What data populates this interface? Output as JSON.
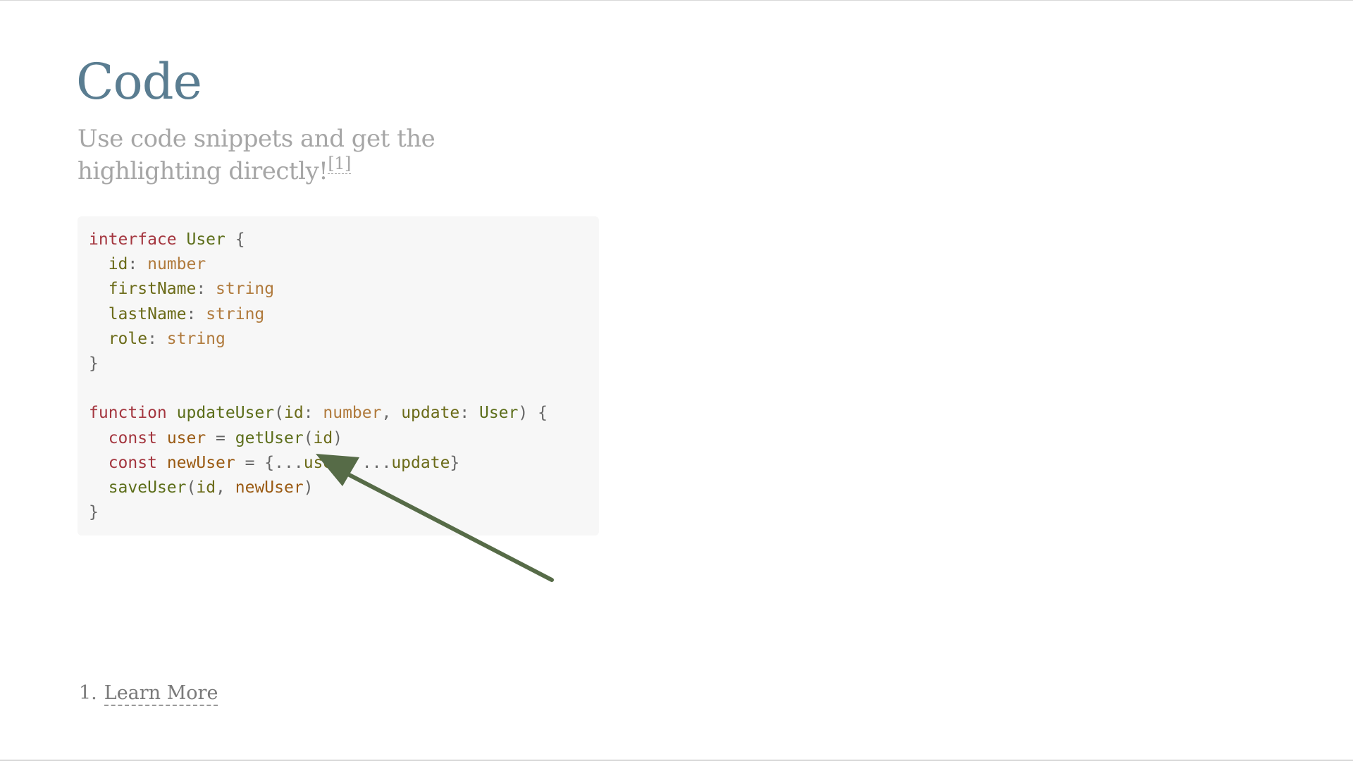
{
  "slide": {
    "title": "Code",
    "subtitle": "Use code snippets and get the highlighting directly!",
    "footnote_ref": "[1]"
  },
  "code": {
    "lines": [
      [
        {
          "t": "interface",
          "c": "kw"
        },
        {
          "t": " "
        },
        {
          "t": "User",
          "c": "ty"
        },
        {
          "t": " {",
          "c": "pn"
        }
      ],
      [
        {
          "t": "  "
        },
        {
          "t": "id",
          "c": "prop"
        },
        {
          "t": ": ",
          "c": "pn"
        },
        {
          "t": "number",
          "c": "bt"
        }
      ],
      [
        {
          "t": "  "
        },
        {
          "t": "firstName",
          "c": "prop"
        },
        {
          "t": ": ",
          "c": "pn"
        },
        {
          "t": "string",
          "c": "bt"
        }
      ],
      [
        {
          "t": "  "
        },
        {
          "t": "lastName",
          "c": "prop"
        },
        {
          "t": ": ",
          "c": "pn"
        },
        {
          "t": "string",
          "c": "bt"
        }
      ],
      [
        {
          "t": "  "
        },
        {
          "t": "role",
          "c": "prop"
        },
        {
          "t": ": ",
          "c": "pn"
        },
        {
          "t": "string",
          "c": "bt"
        }
      ],
      [
        {
          "t": "}",
          "c": "pn"
        }
      ],
      [],
      [
        {
          "t": "function",
          "c": "kw"
        },
        {
          "t": " "
        },
        {
          "t": "updateUser",
          "c": "fn"
        },
        {
          "t": "(",
          "c": "pn"
        },
        {
          "t": "id",
          "c": "prop"
        },
        {
          "t": ": ",
          "c": "pn"
        },
        {
          "t": "number",
          "c": "bt"
        },
        {
          "t": ", ",
          "c": "pn"
        },
        {
          "t": "update",
          "c": "prop"
        },
        {
          "t": ": ",
          "c": "pn"
        },
        {
          "t": "User",
          "c": "ty"
        },
        {
          "t": ") {",
          "c": "pn"
        }
      ],
      [
        {
          "t": "  "
        },
        {
          "t": "const",
          "c": "kw"
        },
        {
          "t": " "
        },
        {
          "t": "user",
          "c": "var"
        },
        {
          "t": " = ",
          "c": "op"
        },
        {
          "t": "getUser",
          "c": "fn"
        },
        {
          "t": "(",
          "c": "pn"
        },
        {
          "t": "id",
          "c": "prop"
        },
        {
          "t": ")",
          "c": "pn"
        }
      ],
      [
        {
          "t": "  "
        },
        {
          "t": "const",
          "c": "kw"
        },
        {
          "t": " "
        },
        {
          "t": "newUser",
          "c": "var"
        },
        {
          "t": " = ",
          "c": "op"
        },
        {
          "t": "{...",
          "c": "pn"
        },
        {
          "t": "user",
          "c": "prop"
        },
        {
          "t": ", ",
          "c": "pn"
        },
        {
          "t": "...",
          "c": "pn"
        },
        {
          "t": "update",
          "c": "prop"
        },
        {
          "t": "}",
          "c": "pn"
        }
      ],
      [
        {
          "t": "  "
        },
        {
          "t": "saveUser",
          "c": "fn"
        },
        {
          "t": "(",
          "c": "pn"
        },
        {
          "t": "id",
          "c": "prop"
        },
        {
          "t": ", ",
          "c": "pn"
        },
        {
          "t": "newUser",
          "c": "var"
        },
        {
          "t": ")",
          "c": "pn"
        }
      ],
      [
        {
          "t": "}",
          "c": "pn"
        }
      ]
    ]
  },
  "annotation": {
    "arrow_color": "#566b47"
  },
  "footnotes": [
    {
      "number": "1.",
      "label": "Learn More"
    }
  ],
  "colors": {
    "title": "#5a7d91",
    "subtitle": "#a6a6a6",
    "code_background": "#f7f7f7",
    "keyword": "#a4363f",
    "builtin_type": "#b07a3c",
    "identifier": "#5c6e1a"
  }
}
